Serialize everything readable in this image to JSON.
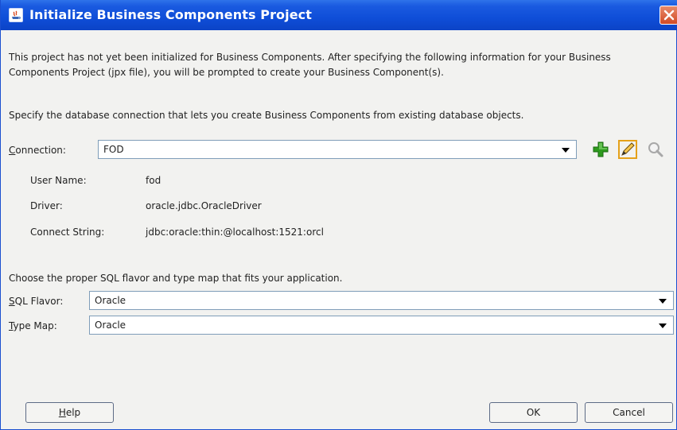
{
  "window": {
    "title": "Initialize Business Components Project"
  },
  "intro": {
    "paragraph": "This project has not yet been initialized for Business Components.  After specifying the following information for your Business Components Project (jpx file), you will be prompted to create your Business Component(s).",
    "connection_instructions": "Specify the database connection that lets you create Business Components from existing database objects.",
    "sql_instructions": "Choose the proper SQL flavor and type map that fits your application."
  },
  "connection": {
    "label_mnemonic": "C",
    "label_rest": "onnection:",
    "value": "FOD",
    "icons": [
      "add-icon",
      "edit-icon",
      "search-icon"
    ]
  },
  "details": {
    "user_name_label": "User Name:",
    "user_name_value": "fod",
    "driver_label": "Driver:",
    "driver_value": "oracle.jdbc.OracleDriver",
    "connect_string_label": "Connect String:",
    "connect_string_value": "jdbc:oracle:thin:@localhost:1521:orcl"
  },
  "sql_flavor": {
    "label_mnemonic": "S",
    "label_rest": "QL Flavor:",
    "value": "Oracle"
  },
  "type_map": {
    "label_mnemonic": "T",
    "label_rest": "ype Map:",
    "value": "Oracle"
  },
  "buttons": {
    "help_mnemonic": "H",
    "help_rest": "elp",
    "ok": "OK",
    "cancel": "Cancel"
  },
  "colors": {
    "titlebar": "#0f4ed8",
    "close": "#d14a25",
    "add_green": "#2e9a1e",
    "edit_orange": "#e5a11a"
  }
}
